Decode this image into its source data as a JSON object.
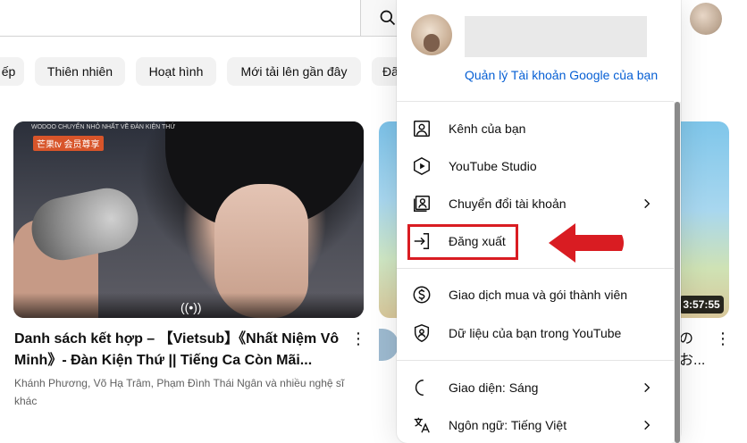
{
  "header": {
    "search_icon": "search-icon"
  },
  "chips": [
    {
      "label": "ếp"
    },
    {
      "label": "Thiên nhiên"
    },
    {
      "label": "Hoạt hình"
    },
    {
      "label": "Mới tải lên gần đây"
    },
    {
      "label": "Đã"
    }
  ],
  "videos": [
    {
      "title": "Danh sách kết hợp – 【Vietsub】《Nhất Niệm Vô Minh》- Đàn Kiện Thứ || Tiếng Ca Còn Mãi...",
      "channel": "Khánh Phương, Võ Hạ Trâm, Phạm Đình Thái Ngân và nhiều nghệ sĩ khác",
      "thumb_caption": "WODOO CHUYỂN NHỎ NHẤT VỀ ĐÀN KIỆN THỨ",
      "thumb_logo": "芒果tv 会员尊享"
    },
    {
      "duration": "3:57:55",
      "title": "の\nお..."
    }
  ],
  "account_menu": {
    "manage_link": "Quản lý Tài khoản Google của bạn",
    "items": [
      {
        "label": "Kênh của bạn",
        "icon": "person-box-icon"
      },
      {
        "label": "YouTube Studio",
        "icon": "studio-icon"
      },
      {
        "label": "Chuyển đổi tài khoản",
        "icon": "switch-account-icon",
        "has_chevron": true
      },
      {
        "label": "Đăng xuất",
        "icon": "sign-out-icon"
      },
      {
        "label": "Giao dịch mua và gói thành viên",
        "icon": "dollar-icon"
      },
      {
        "label": "Dữ liệu của bạn trong YouTube",
        "icon": "shield-person-icon"
      },
      {
        "label": "Giao diện: Sáng",
        "icon": "moon-icon",
        "has_chevron": true
      },
      {
        "label": "Ngôn ngữ: Tiếng Việt",
        "icon": "translate-icon",
        "has_chevron": true
      }
    ]
  },
  "annotation": {
    "highlight_color": "#d91c22",
    "arrow_color": "#d91c22"
  }
}
